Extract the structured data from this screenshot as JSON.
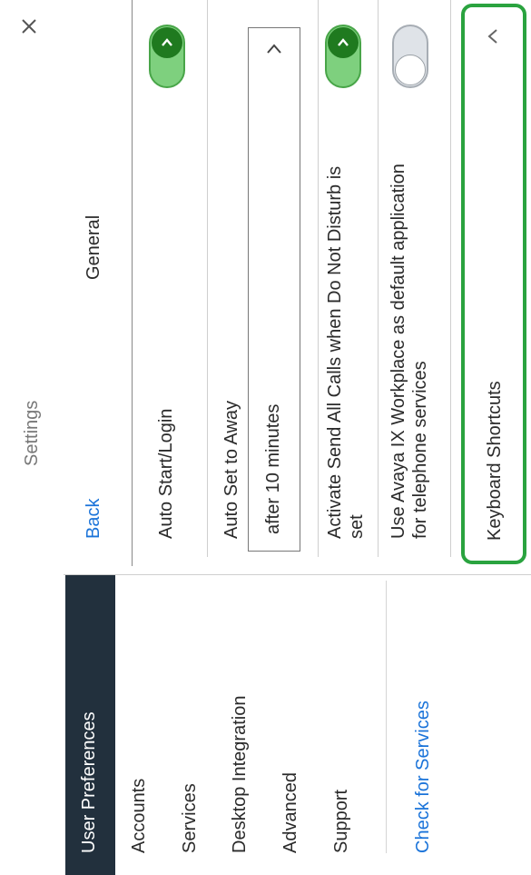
{
  "window": {
    "title": "Settings"
  },
  "sidebar": {
    "items": [
      {
        "label": "User Preferences"
      },
      {
        "label": "Accounts"
      },
      {
        "label": "Services"
      },
      {
        "label": "Desktop Integration"
      },
      {
        "label": "Advanced"
      },
      {
        "label": "Support"
      }
    ],
    "check_services_label": "Check for Services"
  },
  "panel": {
    "back_label": "Back",
    "title": "General",
    "auto_start": {
      "label": "Auto Start/Login",
      "enabled": true
    },
    "auto_away": {
      "label": "Auto Set to Away",
      "value": "after 10 minutes"
    },
    "send_all_calls": {
      "label_line1": "Activate Send All Calls when Do Not Disturb is",
      "label_line2": "set",
      "enabled": true
    },
    "default_app": {
      "label_line1": "Use Avaya IX Workplace as default application",
      "label_line2": "for telephone services",
      "enabled": false
    },
    "keyboard_shortcuts": {
      "label": "Keyboard Shortcuts"
    }
  },
  "colors": {
    "accent": "#1a73d9",
    "toggle_on": "#7ed07e",
    "highlight": "#2aa33f",
    "sidebar_selected": "#22303d"
  },
  "icons": {
    "close": "close-icon",
    "chevron": "chevron-right-icon",
    "collapse": "chevron-up-icon"
  }
}
